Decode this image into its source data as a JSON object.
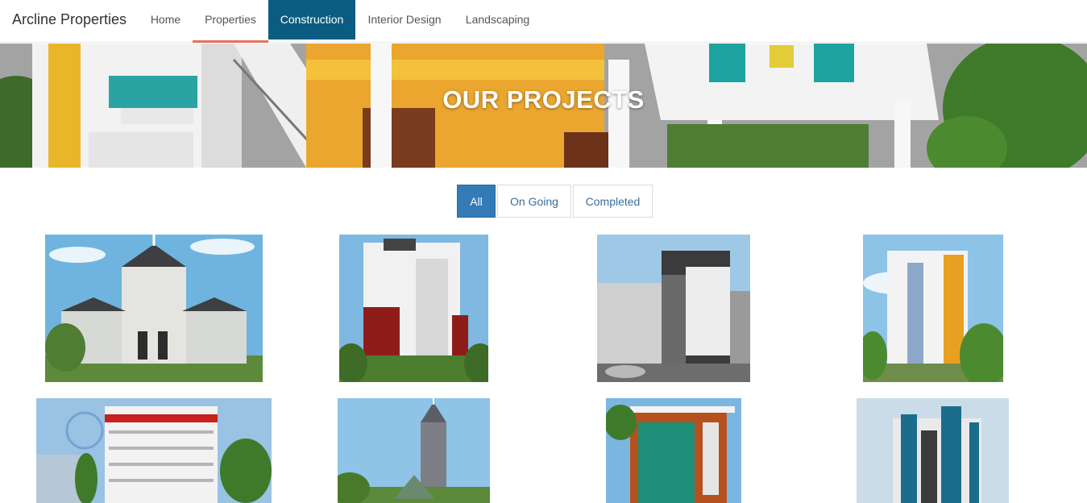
{
  "navbar": {
    "brand": "Arcline Properties",
    "items": [
      {
        "label": "Home"
      },
      {
        "label": "Properties"
      },
      {
        "label": "Construction"
      },
      {
        "label": "Interior Design"
      },
      {
        "label": "Landscaping"
      }
    ]
  },
  "hero": {
    "title": "OUR PROJECTS"
  },
  "filters": [
    {
      "label": "All"
    },
    {
      "label": "On Going"
    },
    {
      "label": "Completed"
    }
  ],
  "colors": {
    "nav_active_fill": "#0a5d80",
    "nav_active_underline": "#e96f59",
    "filter_active": "#337ab7"
  }
}
